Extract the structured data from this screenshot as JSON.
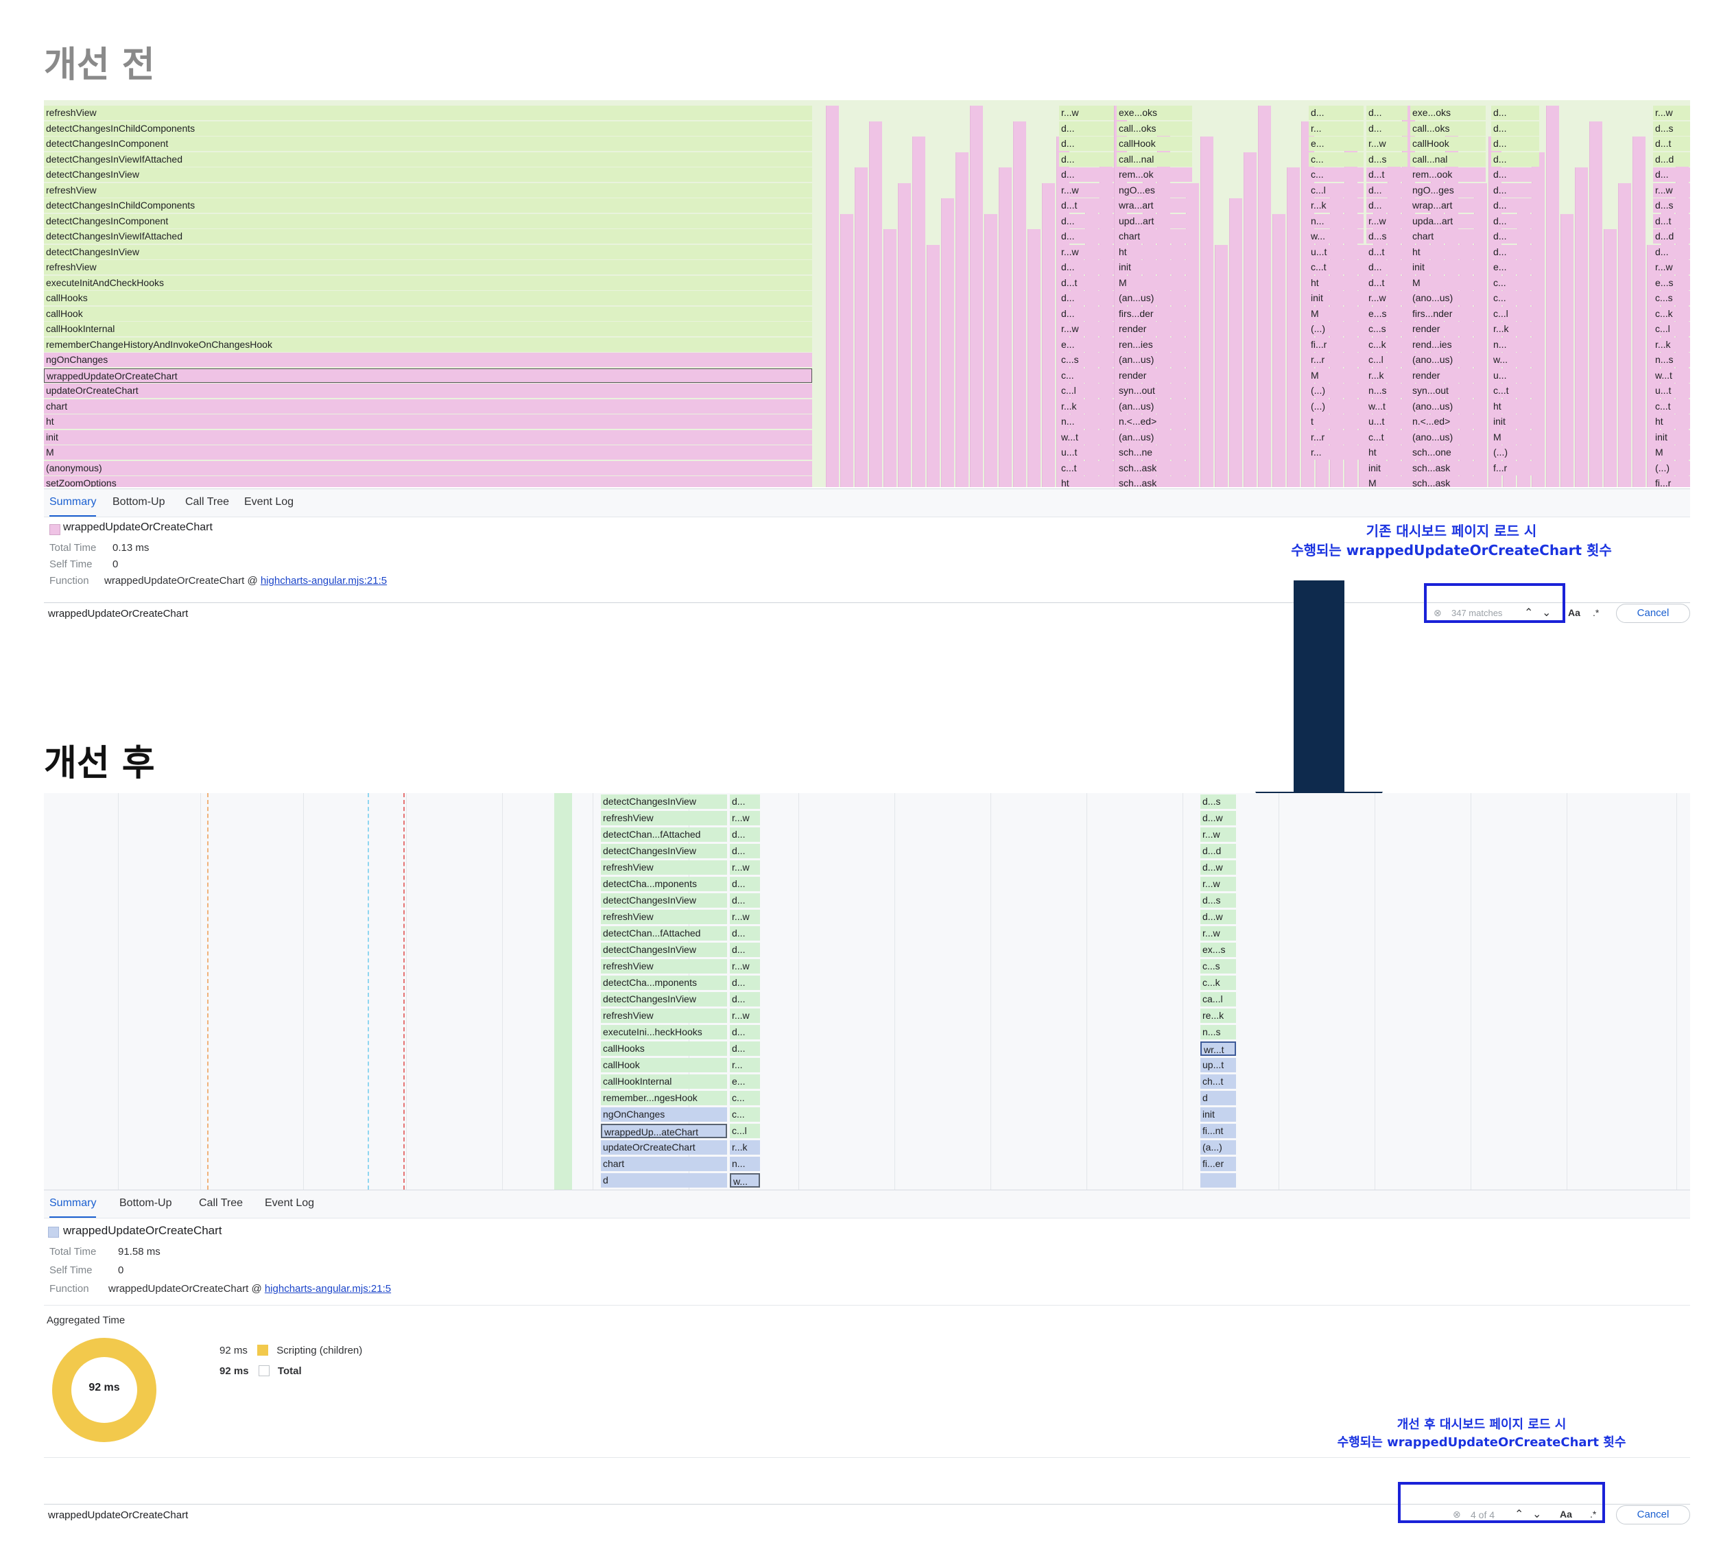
{
  "before": {
    "heading": "개선 전",
    "flame_rows": [
      "refreshView",
      "detectChangesInChildComponents",
      "detectChangesInComponent",
      "detectChangesInViewIfAttached",
      "detectChangesInView",
      "refreshView",
      "detectChangesInChildComponents",
      "detectChangesInComponent",
      "detectChangesInViewIfAttached",
      "detectChangesInView",
      "refreshView",
      "executeInitAndCheckHooks",
      "callHooks",
      "callHook",
      "callHookInternal",
      "rememberChangeHistoryAndInvokeOnChangesHook",
      "ngOnChanges",
      "wrappedUpdateOrCreateChart",
      "updateOrCreateChart",
      "chart",
      "ht",
      "init",
      "M",
      "(anonymous)",
      "setZoomOptions"
    ],
    "col_a": [
      "r...w",
      "d...",
      "d...",
      "d...",
      "d...",
      "r...w",
      "d...t",
      "d...",
      "d...",
      "r...w",
      "d...",
      "d...t",
      "d...",
      "d...",
      "r...w",
      "e...",
      "c...s",
      "c...",
      "c...l",
      "r...k",
      "n...",
      "w...t",
      "u...t",
      "c...t",
      "ht"
    ],
    "col_b": [
      "exe...oks",
      "call...oks",
      "callHook",
      "call...nal",
      "rem...ok",
      "ngO...es",
      "wra...art",
      "upd...art",
      "chart",
      "ht",
      "init",
      "M",
      "(an...us)",
      "firs...der",
      "render",
      "ren...ies",
      "(an...us)",
      "render",
      "syn...out",
      "(an...us)",
      "n.<...ed>",
      "(an...us)",
      "sch...ne",
      "sch...ask",
      "sch...ask"
    ],
    "col_c": [
      "d...",
      "r...",
      "e...",
      "c...",
      "c...",
      "c...l",
      "r...k",
      "n...",
      "w...",
      "u...t",
      "c...t",
      "ht",
      "init",
      "M",
      "(...)",
      "fi...r",
      "r...r",
      "M",
      "(...)",
      "(...)",
      "t",
      "r...r",
      "r...",
      "",
      ""
    ],
    "col_d": [
      "d...",
      "d...",
      "r...w",
      "d...s",
      "d...t",
      "d...",
      "d...",
      "r...w",
      "d...s",
      "d...t",
      "d...",
      "d...t",
      "r...w",
      "e...s",
      "c...s",
      "c...k",
      "c...l",
      "r...k",
      "n...s",
      "w...t",
      "u...t",
      "c...t",
      "ht",
      "init",
      "M"
    ],
    "col_e": [
      "exe...oks",
      "call...oks",
      "callHook",
      "call...nal",
      "rem...ook",
      "ngO...ges",
      "wrap...art",
      "upda...art",
      "chart",
      "ht",
      "init",
      "M",
      "(ano...us)",
      "firs...nder",
      "render",
      "rend...ies",
      "(ano...us)",
      "render",
      "syn...out",
      "(ano...us)",
      "n.<...ed>",
      "(ano...us)",
      "sch...one",
      "sch...ask",
      "sch...ask"
    ],
    "col_f": [
      "d...",
      "d...",
      "d...",
      "d...",
      "d...",
      "d...",
      "d...",
      "d...",
      "d...",
      "d...",
      "e...",
      "c...",
      "c...",
      "c...l",
      "r...k",
      "n...",
      "w...",
      "u...",
      "c...t",
      "ht",
      "init",
      "M",
      "(...)",
      "f...r",
      ""
    ],
    "col_g": [
      "r...w",
      "d...s",
      "d...t",
      "d...d",
      "d...",
      "r...w",
      "d...s",
      "d...t",
      "d...d",
      "d...",
      "r...w",
      "e...s",
      "c...s",
      "c...k",
      "c...l",
      "r...k",
      "n...s",
      "w...t",
      "u...t",
      "c...t",
      "ht",
      "init",
      "M",
      "(...)",
      "fi...r"
    ],
    "tabs": [
      "Summary",
      "Bottom-Up",
      "Call Tree",
      "Event Log"
    ],
    "summary": {
      "name": "wrappedUpdateOrCreateChart",
      "total_time_label": "Total Time",
      "total_time": "0.13 ms",
      "self_time_label": "Self Time",
      "self_time": "0",
      "function_label": "Function",
      "function_name": "wrappedUpdateOrCreateChart @",
      "function_link": "highcharts-angular.mjs:21:5"
    },
    "annotation_line1": "기존 대시보드 페이지 로드 시",
    "annotation_line2": "수행되는 wrappedUpdateOrCreateChart 횟수",
    "search_value": "wrappedUpdateOrCreateChart",
    "match_text": "347 matches",
    "aa_label": "Aa",
    "cancel_label": "Cancel"
  },
  "after": {
    "heading": "개선 후",
    "flame_rows": [
      "detectChangesInView",
      "refreshView",
      "detectChan...fAttached",
      "detectChangesInView",
      "refreshView",
      "detectCha...mponents",
      "detectChangesInView",
      "refreshView",
      "detectChan...fAttached",
      "detectChangesInView",
      "refreshView",
      "detectCha...mponents",
      "detectChangesInView",
      "refreshView",
      "executeIni...heckHooks",
      "callHooks",
      "callHook",
      "callHookInternal",
      "remember...ngesHook",
      "ngOnChanges",
      "wrappedUp...ateChart",
      "updateOrCreateChart",
      "chart",
      "d"
    ],
    "col_a": [
      "d...",
      "r...w",
      "d...",
      "d...",
      "r...w",
      "d...",
      "d...",
      "r...w",
      "d...",
      "d...",
      "r...w",
      "d...",
      "d...",
      "r...w",
      "d...",
      "d...",
      "r...",
      "e...",
      "c...",
      "c...",
      "c...l",
      "r...k",
      "n...",
      "w..."
    ],
    "col_b": [
      "d...s",
      "d...w",
      "r...w",
      "d...d",
      "d...w",
      "r...w",
      "d...s",
      "d...w",
      "r...w",
      "ex...s",
      "c...s",
      "c...k",
      "ca...l",
      "re...k",
      "n...s",
      "wr...t",
      "up...t",
      "ch...t",
      "d",
      "init",
      "fi...nt",
      "(a...)",
      "fi...er",
      ""
    ],
    "tabs": [
      "Summary",
      "Bottom-Up",
      "Call Tree",
      "Event Log"
    ],
    "summary": {
      "name": "wrappedUpdateOrCreateChart",
      "total_time_label": "Total Time",
      "total_time": "91.58 ms",
      "self_time_label": "Self Time",
      "self_time": "0",
      "function_label": "Function",
      "function_name": "wrappedUpdateOrCreateChart @",
      "function_link": "highcharts-angular.mjs:21:5"
    },
    "aggregated_title": "Aggregated Time",
    "donut_label": "92 ms",
    "legend": [
      {
        "value": "92 ms",
        "label": "Scripting (children)",
        "color": "#f2c94c"
      },
      {
        "value": "92 ms",
        "label": "Total",
        "color": "#ffffff"
      }
    ],
    "annotation_line1": "개선 후 대시보드 페이지 로드 시",
    "annotation_line2": "수행되는 wrappedUpdateOrCreateChart 횟수",
    "search_value": "wrappedUpdateOrCreateChart",
    "match_text": "4 of 4",
    "aa_label": "Aa",
    "cancel_label": "Cancel"
  },
  "colors": {
    "green": "#ddf1c3",
    "pink": "#efc3e5",
    "light_green": "#d3f0d3",
    "light_blue": "#c5d3ee",
    "annotation_blue": "#1a33e0",
    "arrow": "#0e2a4d"
  }
}
